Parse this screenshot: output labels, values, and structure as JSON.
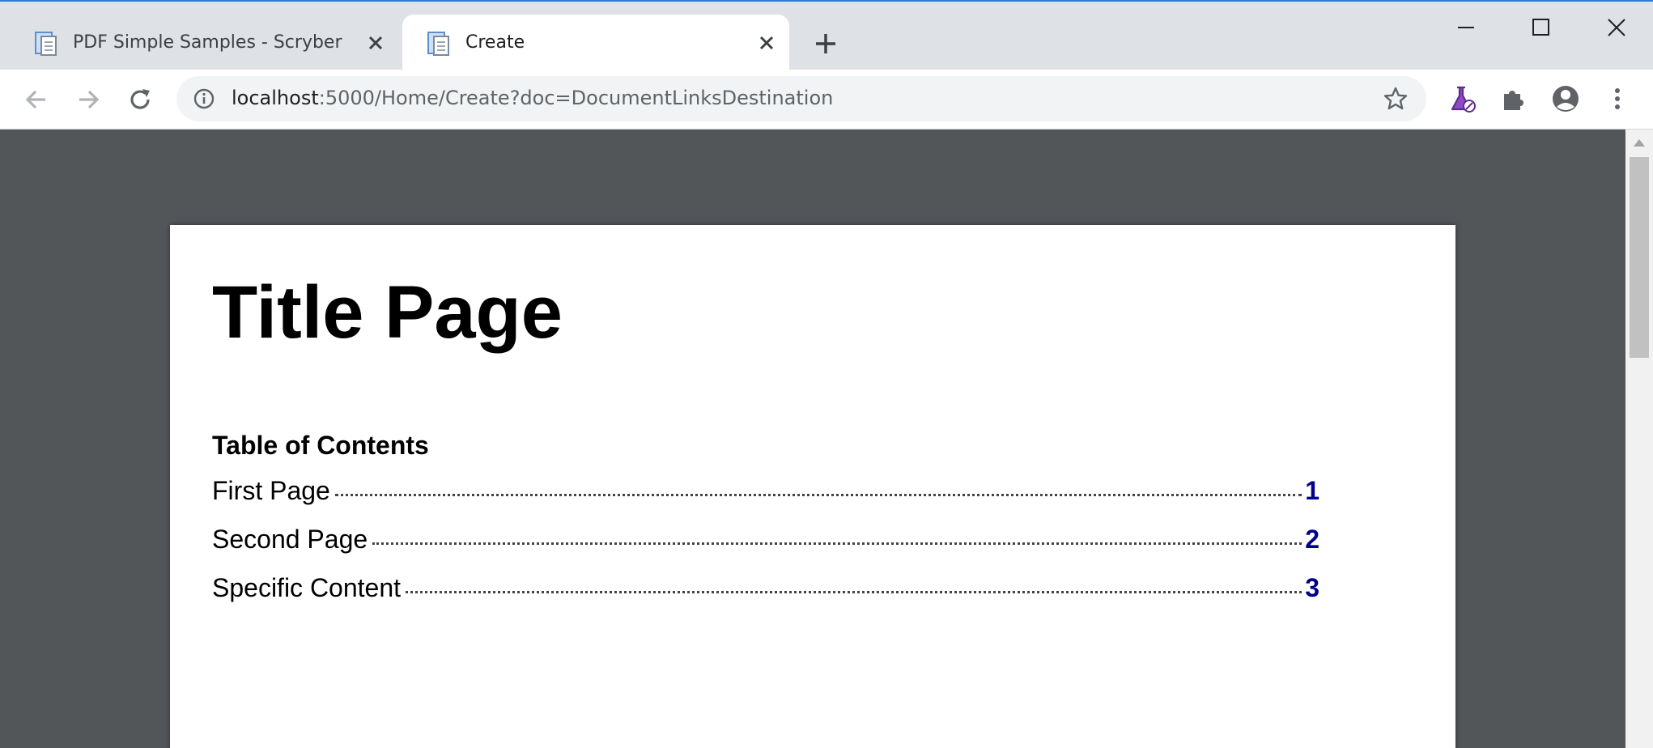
{
  "browser": {
    "tabs": [
      {
        "title": "PDF Simple Samples - Scryber",
        "active": false
      },
      {
        "title": "Create",
        "active": true
      }
    ],
    "url_host": "localhost",
    "url_rest": ":5000/Home/Create?doc=DocumentLinksDestination",
    "accent_color": "#2b7bd3",
    "toolbar_icons": [
      "back-icon",
      "forward-icon",
      "reload-icon",
      "info-icon",
      "star-icon",
      "labs-icon",
      "extensions-icon",
      "profile-icon",
      "menu-icon"
    ]
  },
  "document": {
    "title": "Title Page",
    "toc_heading": "Table of Contents",
    "toc": [
      {
        "label": "First Page",
        "page": "1"
      },
      {
        "label": "Second Page",
        "page": "2"
      },
      {
        "label": "Specific Content",
        "page": "3"
      }
    ],
    "link_color": "#00008b"
  }
}
